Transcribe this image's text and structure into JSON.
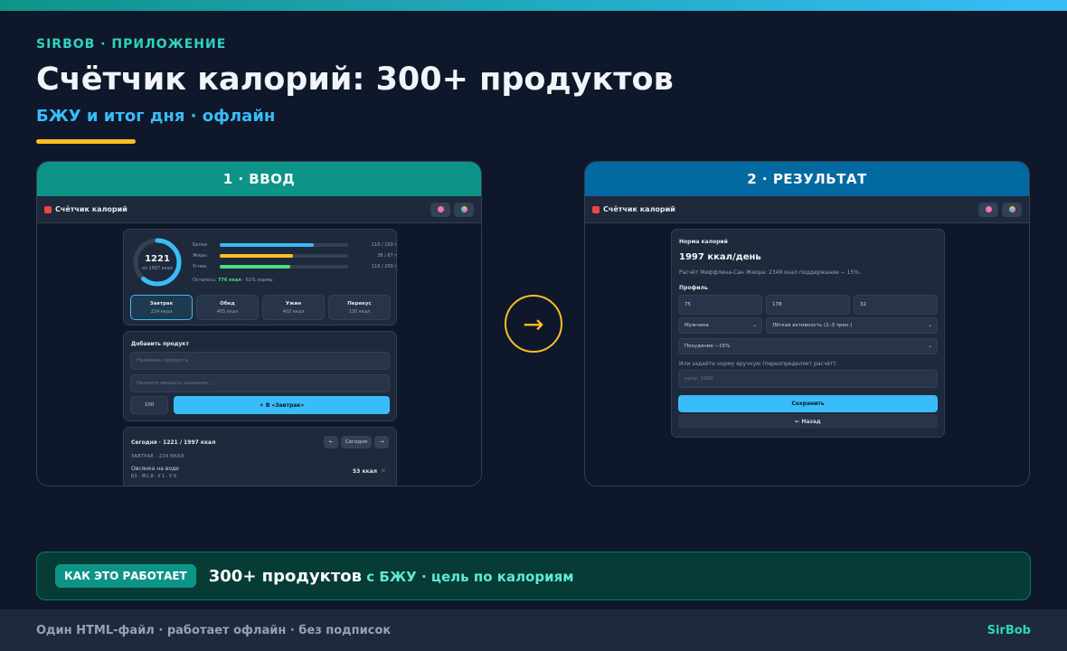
{
  "header": {
    "brand": "SIRBOB · ПРИЛОЖЕНИЕ",
    "title": "Счётчик калорий: 300+ продуктов",
    "subtitle": "БЖУ и итог дня · офлайн"
  },
  "colors": {
    "teal": "#0d9488",
    "blue": "#0369a1",
    "accent": "#fbbf24",
    "sky": "#38bdf8"
  },
  "panel1": {
    "heading": "1 · ВВОД",
    "app": {
      "title": "Счётчик калорий",
      "ring": {
        "value": "1221",
        "sub": "из 1997 ккал",
        "progress": 0.61
      },
      "macros": [
        {
          "label": "Белки",
          "value": "110 / 150 г",
          "fraction": 0.73,
          "color": "#38bdf8"
        },
        {
          "label": "Жиры",
          "value": "38 / 67 г",
          "fraction": 0.57,
          "color": "#fbbf24"
        },
        {
          "label": "Углев.",
          "value": "110 / 200 г",
          "fraction": 0.55,
          "color": "#4ade80"
        }
      ],
      "remaining_prefix": "Осталось: ",
      "remaining_value": "776 ккал",
      "remaining_suffix": " · 61% нормы",
      "meals": [
        {
          "name": "Завтрак",
          "kcal": "224 ккал"
        },
        {
          "name": "Обед",
          "kcal": "465 ккал"
        },
        {
          "name": "Ужин",
          "kcal": "402 ккал"
        },
        {
          "name": "Перекус",
          "kcal": "130 ккал"
        }
      ],
      "add": {
        "title": "Добавить продукт",
        "product_placeholder": "Название продукта…",
        "search_placeholder": "Начните вводить название…",
        "grams": "100",
        "add_button": "+ В «Завтрак»"
      },
      "today": {
        "title": "Сегодня · 1221 / 1997 ккал",
        "prev": "←",
        "today_btn": "Сегодня",
        "next": "→",
        "section": "ЗАВТРАК · 224 ККАЛ",
        "item_name": "Овсянка на воде",
        "item_macros": "Б3 · Ж1.8 · У 1 · У 9",
        "item_kcal": "53 ккал",
        "remove": "✕"
      }
    }
  },
  "panel2": {
    "heading": "2 · РЕЗУЛЬТАТ",
    "app": {
      "title": "Счётчик калорий",
      "norm_label": "Норма калорий",
      "norm_value": "1997 ккал/день",
      "formula": "Расчёт Миффлина-Сан Жеора: 2349 ккал поддержание − 15%.",
      "profile_label": "Профиль",
      "weight": "75",
      "height": "178",
      "age": "32",
      "sex": "Мужчина",
      "activity": "Лёгкая активность (1–3 трен.)",
      "goal": "Похудение −15%",
      "manual_label": "Или задайте норму вручную (переопределяет расчёт):",
      "manual_placeholder": "напр. 1900",
      "save": "Сохранить",
      "back": "← Назад"
    }
  },
  "arrow": "→",
  "how": {
    "badge": "КАК ЭТО РАБОТАЕТ",
    "strong": "300+ продуктов",
    "rest": " с БЖУ · цель по калориям"
  },
  "footer": {
    "text": "Один HTML-файл · работает офлайн · без подписок",
    "logo": "SirBob"
  }
}
